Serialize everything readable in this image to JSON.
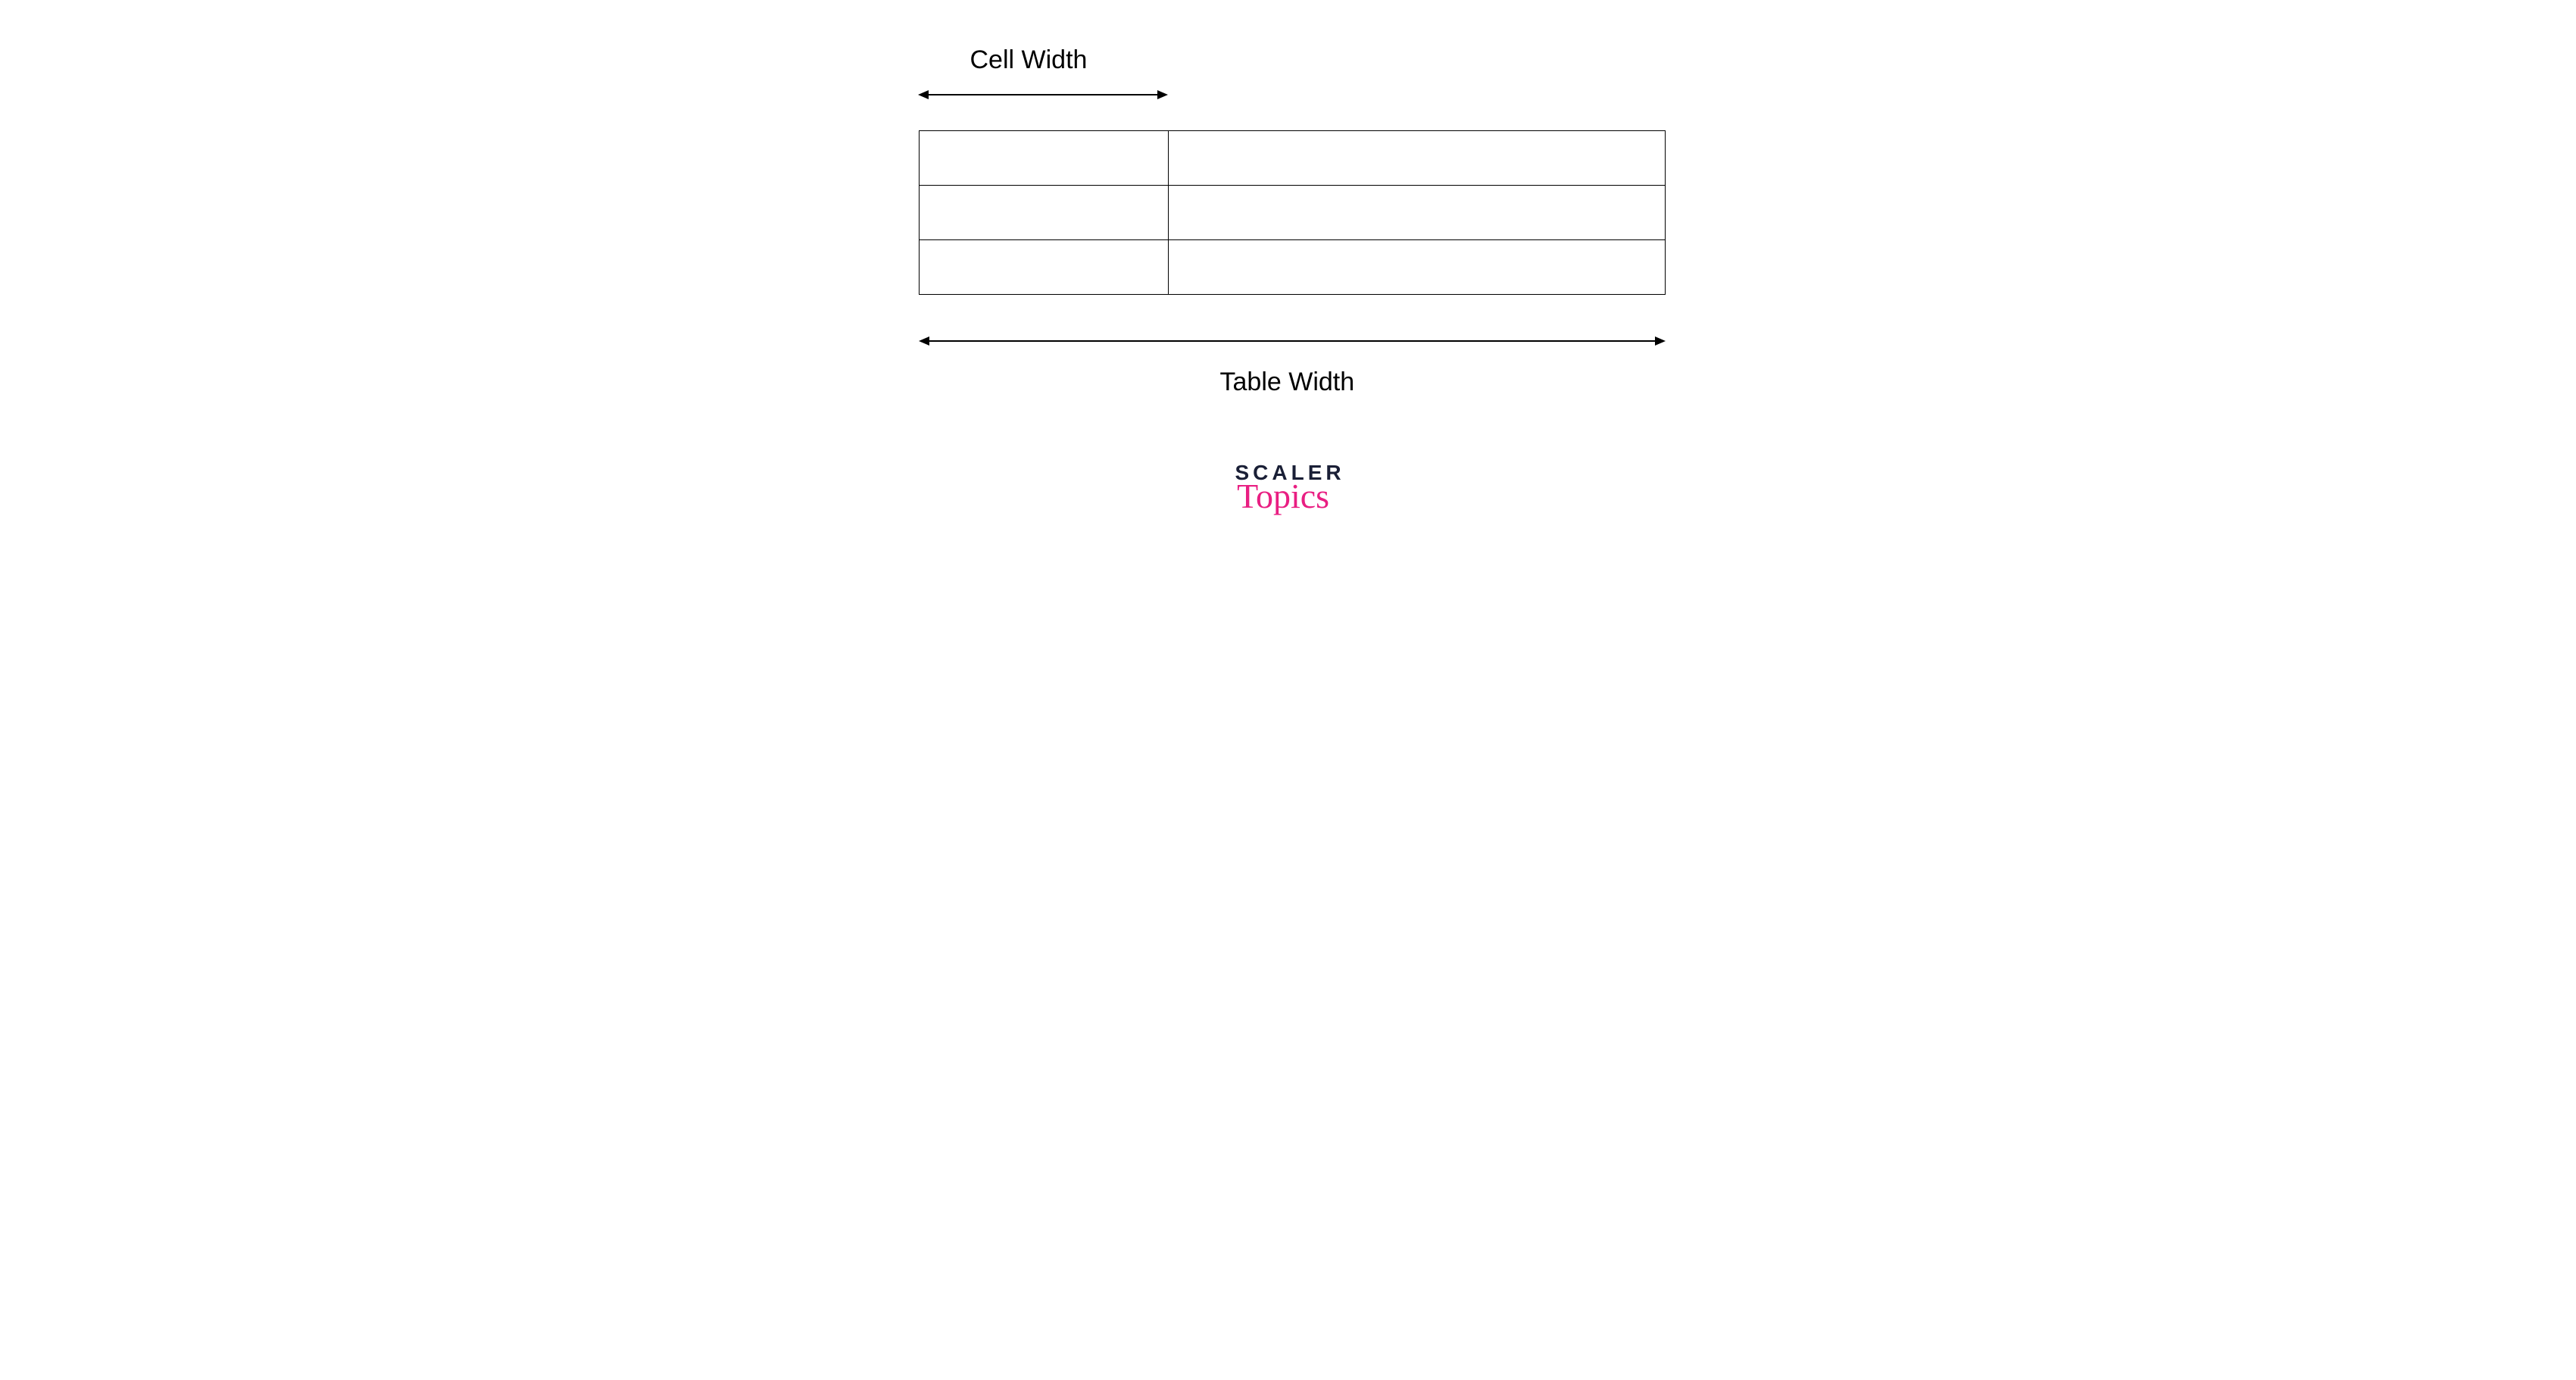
{
  "labels": {
    "cell_width": "Cell Width",
    "table_width": "Table Width"
  },
  "brand": {
    "line1": "SCALER",
    "line2": "Topics"
  },
  "table": {
    "rows": 3,
    "cols": 2
  }
}
